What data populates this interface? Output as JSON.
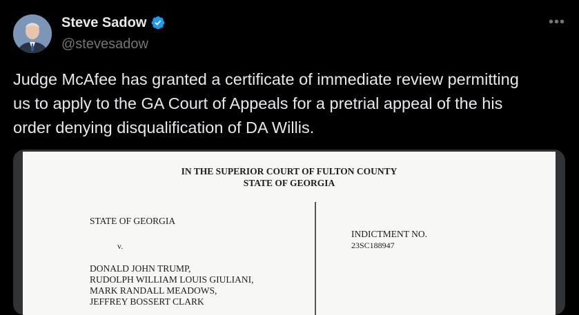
{
  "author": {
    "display_name": "Steve Sadow",
    "handle": "@stevesadow",
    "verified_color": "#1d9bf0"
  },
  "menu": {
    "more_label": "•••"
  },
  "tweet": {
    "text": "Judge McAfee has granted a certificate of immediate review permitting\nus to apply to the GA Court of Appeals for a pretrial appeal of the his\norder denying disqualification of DA Willis."
  },
  "document": {
    "court_line1": "IN THE SUPERIOR COURT OF FULTON COUNTY",
    "court_line2": "STATE OF GEORGIA",
    "plaintiff": "STATE OF GEORGIA",
    "versus": "v.",
    "defendants": [
      "DONALD JOHN TRUMP,",
      "RUDOLPH WILLIAM LOUIS GIULIANI,",
      "MARK RANDALL MEADOWS,",
      "JEFFREY BOSSERT CLARK"
    ],
    "indictment_label": "INDICTMENT NO.",
    "indictment_number": "23SC188947"
  }
}
